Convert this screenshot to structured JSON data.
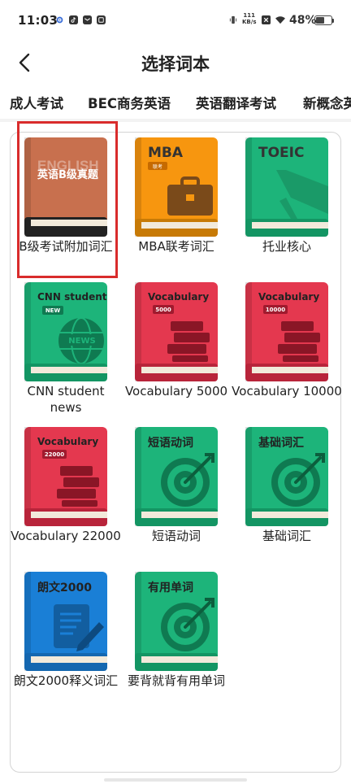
{
  "status_bar": {
    "time": "11:03",
    "net_speed_value": "111",
    "net_speed_unit": "KB/s",
    "battery_text": "48%",
    "battery_level": 0.48
  },
  "header": {
    "title": "选择词本"
  },
  "tabs": [
    {
      "label": "成人考试"
    },
    {
      "label": "BEC商务英语"
    },
    {
      "label": "英语翻译考试"
    },
    {
      "label": "新概念英"
    }
  ],
  "books": [
    {
      "label": "B级考试附加词汇",
      "color": "#c8704e",
      "cover_title": "英语B级真题",
      "cover_watermark": "ENGLISH",
      "icon": "book-icon"
    },
    {
      "label": "MBA联考词汇",
      "color": "#f7960f",
      "cover_title": "MBA",
      "cover_badge": "联考",
      "icon": "briefcase-icon"
    },
    {
      "label": "托业核心",
      "color": "#1db47a",
      "cover_title": "TOEIC",
      "icon": "airplane-icon"
    },
    {
      "label": "CNN student news",
      "color": "#1db47a",
      "cover_title": "CNN student",
      "cover_badge": "NEW",
      "icon": "news-globe-icon"
    },
    {
      "label": "Vocabulary 5000",
      "color": "#e4384f",
      "cover_title": "Vocabulary",
      "cover_badge": "5000",
      "icon": "book-stack-icon"
    },
    {
      "label": "Vocabulary 10000",
      "color": "#e4384f",
      "cover_title": "Vocabulary",
      "cover_badge": "10000",
      "icon": "book-stack-icon"
    },
    {
      "label": "Vocabulary 22000",
      "color": "#e4384f",
      "cover_title": "Vocabulary",
      "cover_badge": "22000",
      "icon": "book-stack-icon"
    },
    {
      "label": "短语动词",
      "color": "#1db47a",
      "cover_title": "短语动词",
      "icon": "target-icon"
    },
    {
      "label": "基础词汇",
      "color": "#1db47a",
      "cover_title": "基础词汇",
      "icon": "target-icon"
    },
    {
      "label": "朗文2000释义词汇",
      "color": "#1a7fd6",
      "cover_title": "朗文2000",
      "icon": "document-pen-icon"
    },
    {
      "label": "要背就背有用单词",
      "color": "#1db47a",
      "cover_title": "有用单词",
      "icon": "target-icon"
    }
  ],
  "selected_index": 0
}
